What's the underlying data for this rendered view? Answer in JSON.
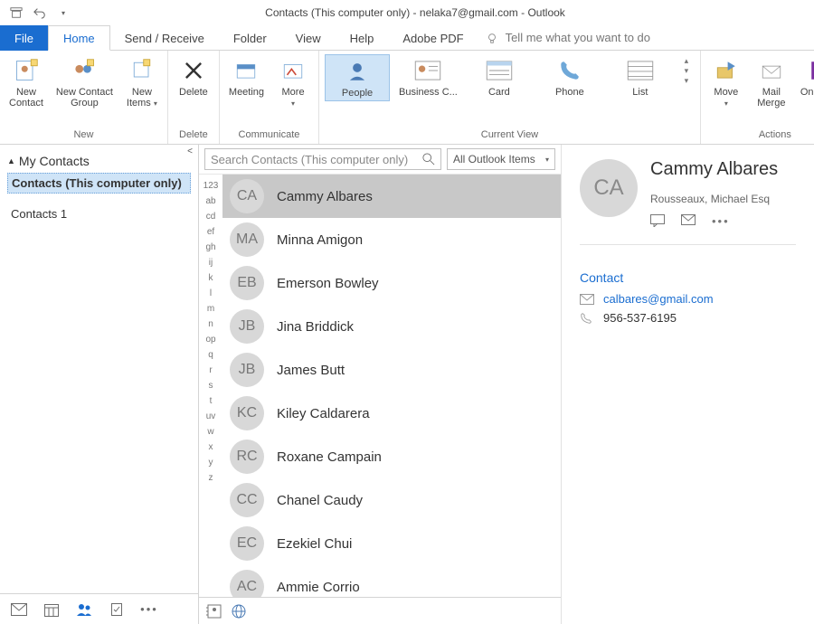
{
  "titlebar": {
    "title": "Contacts (This computer only) - nelaka7@gmail.com  -  Outlook"
  },
  "tabs": {
    "file": "File",
    "home": "Home",
    "send_receive": "Send / Receive",
    "folder": "Folder",
    "view": "View",
    "help": "Help",
    "adobe_pdf": "Adobe PDF",
    "tell_me": "Tell me what you want to do"
  },
  "ribbon": {
    "new": {
      "label": "New",
      "new_contact": "New\nContact",
      "new_group": "New Contact\nGroup",
      "new_items": "New\nItems"
    },
    "delete": {
      "label": "Delete",
      "delete": "Delete"
    },
    "communicate": {
      "label": "Communicate",
      "meeting": "Meeting",
      "more": "More"
    },
    "current_view": {
      "label": "Current View",
      "people": "People",
      "business_card": "Business C...",
      "card": "Card",
      "phone": "Phone",
      "list": "List"
    },
    "actions": {
      "label": "Actions",
      "move": "Move",
      "mail_merge": "Mail\nMerge",
      "onenote": "OneNote"
    }
  },
  "leftnav": {
    "heading": "My Contacts",
    "items": [
      "Contacts (This computer only)",
      "Contacts 1"
    ]
  },
  "search": {
    "placeholder": "Search Contacts (This computer only)",
    "scope": "All Outlook Items"
  },
  "az_index": [
    "123",
    "ab",
    "cd",
    "ef",
    "gh",
    "ij",
    "k",
    "l",
    "m",
    "n",
    "op",
    "q",
    "r",
    "s",
    "t",
    "uv",
    "w",
    "x",
    "y",
    "z"
  ],
  "contacts": [
    {
      "initials": "CA",
      "name": "Cammy Albares",
      "selected": true
    },
    {
      "initials": "MA",
      "name": "Minna Amigon"
    },
    {
      "initials": "EB",
      "name": "Emerson Bowley"
    },
    {
      "initials": "JB",
      "name": "Jina Briddick"
    },
    {
      "initials": "JB",
      "name": "James Butt"
    },
    {
      "initials": "KC",
      "name": "Kiley Caldarera"
    },
    {
      "initials": "RC",
      "name": "Roxane Campain"
    },
    {
      "initials": "CC",
      "name": "Chanel Caudy"
    },
    {
      "initials": "EC",
      "name": "Ezekiel Chui"
    },
    {
      "initials": "AC",
      "name": "Ammie Corrio"
    }
  ],
  "detail": {
    "initials": "CA",
    "name": "Cammy Albares",
    "company": "Rousseaux, Michael Esq",
    "section": "Contact",
    "email": "calbares@gmail.com",
    "phone": "956-537-6195"
  }
}
